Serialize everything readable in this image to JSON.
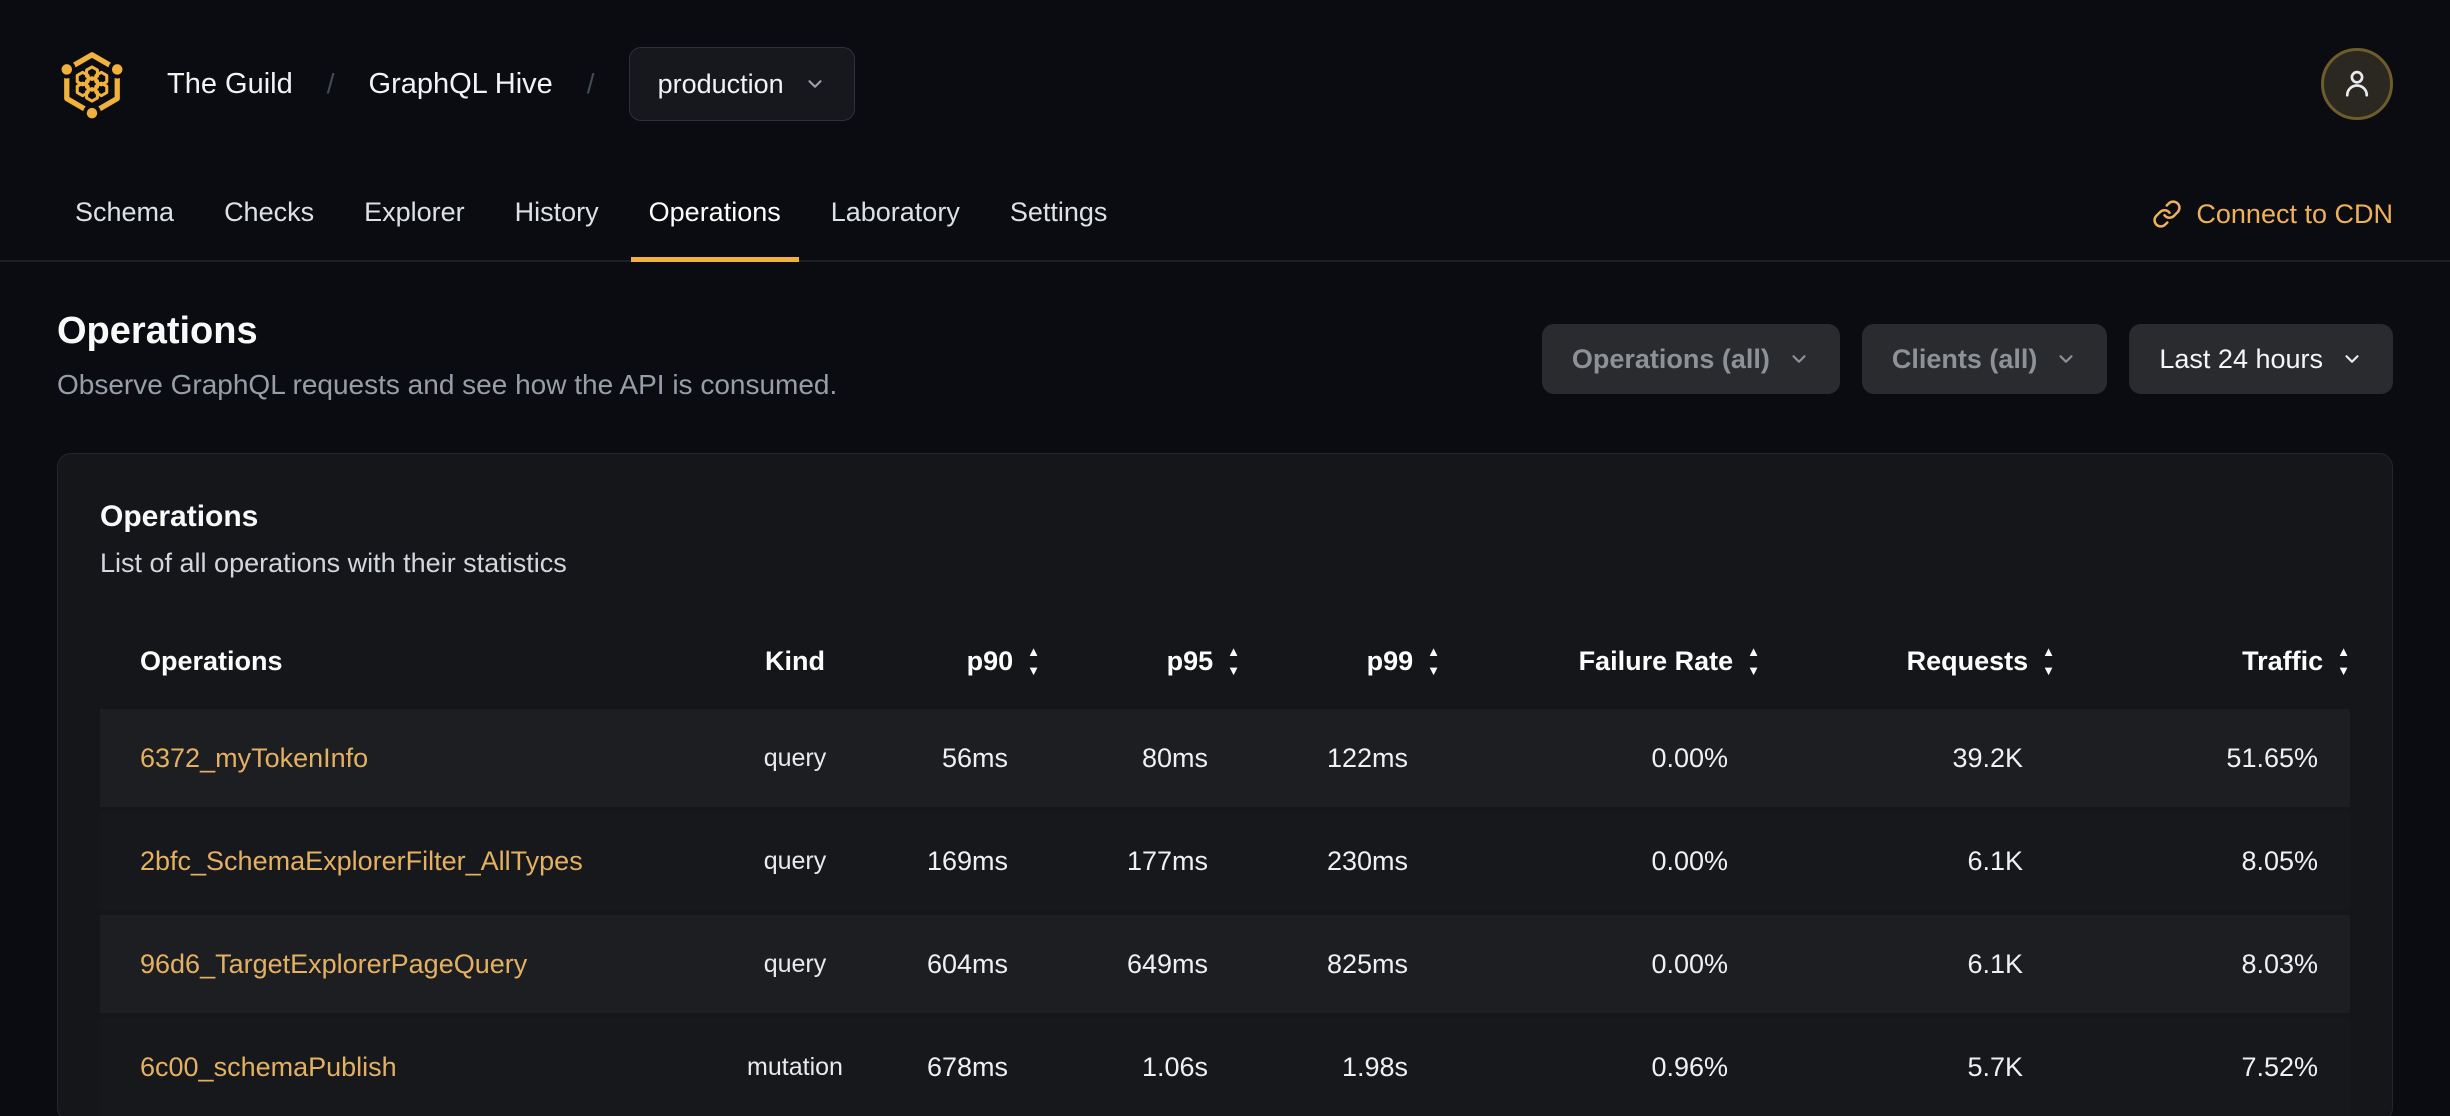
{
  "breadcrumb": {
    "org": "The Guild",
    "separator": "/",
    "project": "GraphQL Hive",
    "environment": "production"
  },
  "nav": {
    "tabs": [
      {
        "label": "Schema",
        "active": false
      },
      {
        "label": "Checks",
        "active": false
      },
      {
        "label": "Explorer",
        "active": false
      },
      {
        "label": "History",
        "active": false
      },
      {
        "label": "Operations",
        "active": true
      },
      {
        "label": "Laboratory",
        "active": false
      },
      {
        "label": "Settings",
        "active": false
      }
    ],
    "cdn_label": "Connect to CDN"
  },
  "page": {
    "title": "Operations",
    "subtitle": "Observe GraphQL requests and see how the API is consumed."
  },
  "filters": {
    "operations": "Operations (all)",
    "clients": "Clients (all)",
    "period": "Last 24 hours"
  },
  "card": {
    "title": "Operations",
    "subtitle": "List of all operations with their statistics",
    "table": {
      "columns": [
        {
          "label": "Operations",
          "sortable": false
        },
        {
          "label": "Kind",
          "sortable": false
        },
        {
          "label": "p90",
          "sortable": true
        },
        {
          "label": "p95",
          "sortable": true
        },
        {
          "label": "p99",
          "sortable": true
        },
        {
          "label": "Failure Rate",
          "sortable": true
        },
        {
          "label": "Requests",
          "sortable": true
        },
        {
          "label": "Traffic",
          "sortable": true
        }
      ],
      "rows": [
        {
          "name": "6372_myTokenInfo",
          "kind": "query",
          "p90": "56ms",
          "p95": "80ms",
          "p99": "122ms",
          "failure_rate": "0.00%",
          "requests": "39.2K",
          "traffic": "51.65%"
        },
        {
          "name": "2bfc_SchemaExplorerFilter_AllTypes",
          "kind": "query",
          "p90": "169ms",
          "p95": "177ms",
          "p99": "230ms",
          "failure_rate": "0.00%",
          "requests": "6.1K",
          "traffic": "8.05%"
        },
        {
          "name": "96d6_TargetExplorerPageQuery",
          "kind": "query",
          "p90": "604ms",
          "p95": "649ms",
          "p99": "825ms",
          "failure_rate": "0.00%",
          "requests": "6.1K",
          "traffic": "8.03%"
        },
        {
          "name": "6c00_schemaPublish",
          "kind": "mutation",
          "p90": "678ms",
          "p95": "1.06s",
          "p99": "1.98s",
          "failure_rate": "0.96%",
          "requests": "5.7K",
          "traffic": "7.52%"
        }
      ]
    }
  },
  "colors": {
    "accent": "#f0b13d",
    "link": "#e4b062",
    "page_bg": "#0a0c11",
    "card_bg": "#15161a"
  }
}
